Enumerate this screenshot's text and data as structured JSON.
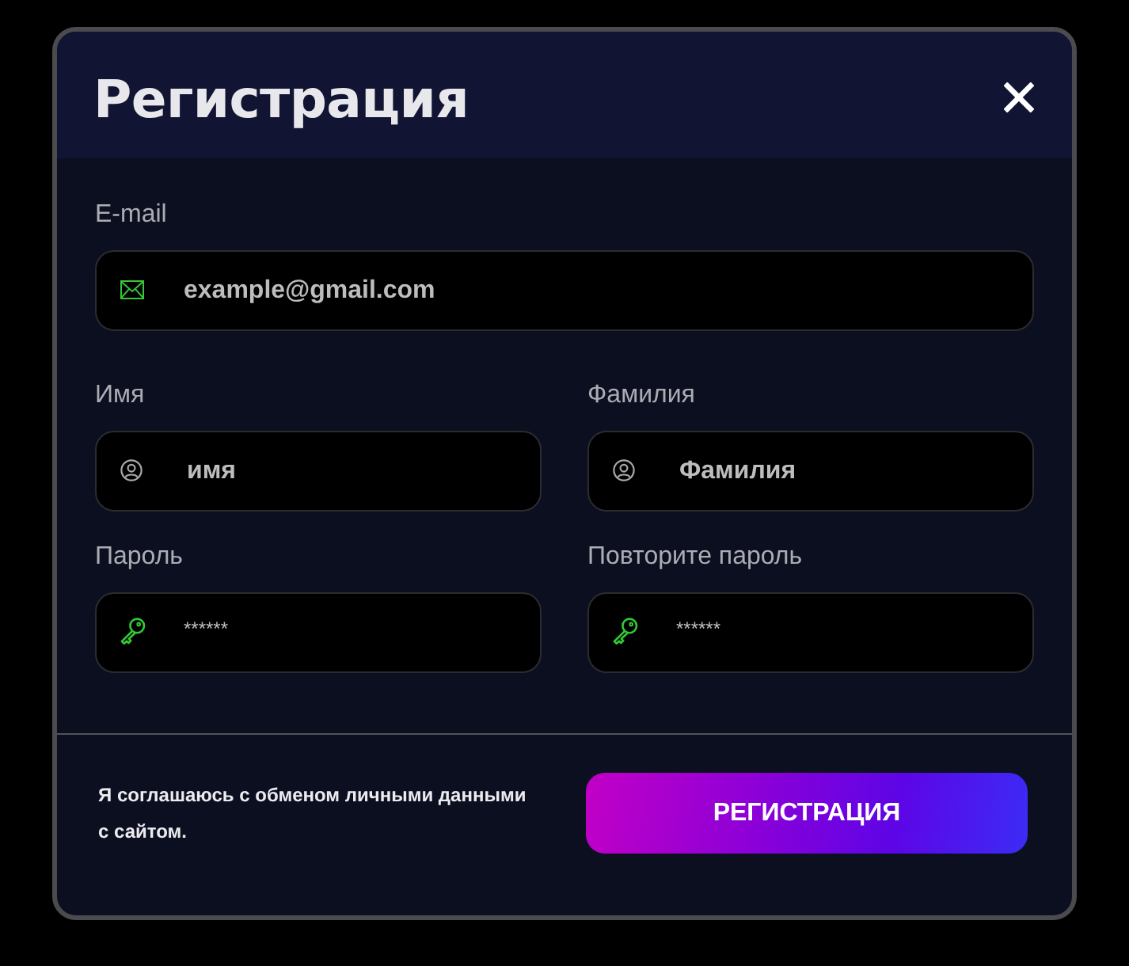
{
  "dialog": {
    "title": "Регистрация"
  },
  "rows": [
    {
      "fields": [
        {
          "kind": "email",
          "label": "E-mail",
          "placeholder": "example@gmail.com"
        }
      ]
    },
    {
      "fields": [
        {
          "kind": "name",
          "label": "Имя",
          "placeholder": "имя"
        },
        {
          "kind": "name",
          "label": "Фамилия",
          "placeholder": "Фамилия"
        }
      ]
    },
    {
      "fields": [
        {
          "kind": "password",
          "label": "Пароль",
          "placeholder": "******"
        },
        {
          "kind": "password",
          "label": "Повторите пароль",
          "placeholder": "******"
        }
      ]
    }
  ],
  "footer": {
    "consent": "Я соглашаюсь с обменом личными данными с сайтом.",
    "submit": "РЕГИСТРАЦИЯ"
  }
}
